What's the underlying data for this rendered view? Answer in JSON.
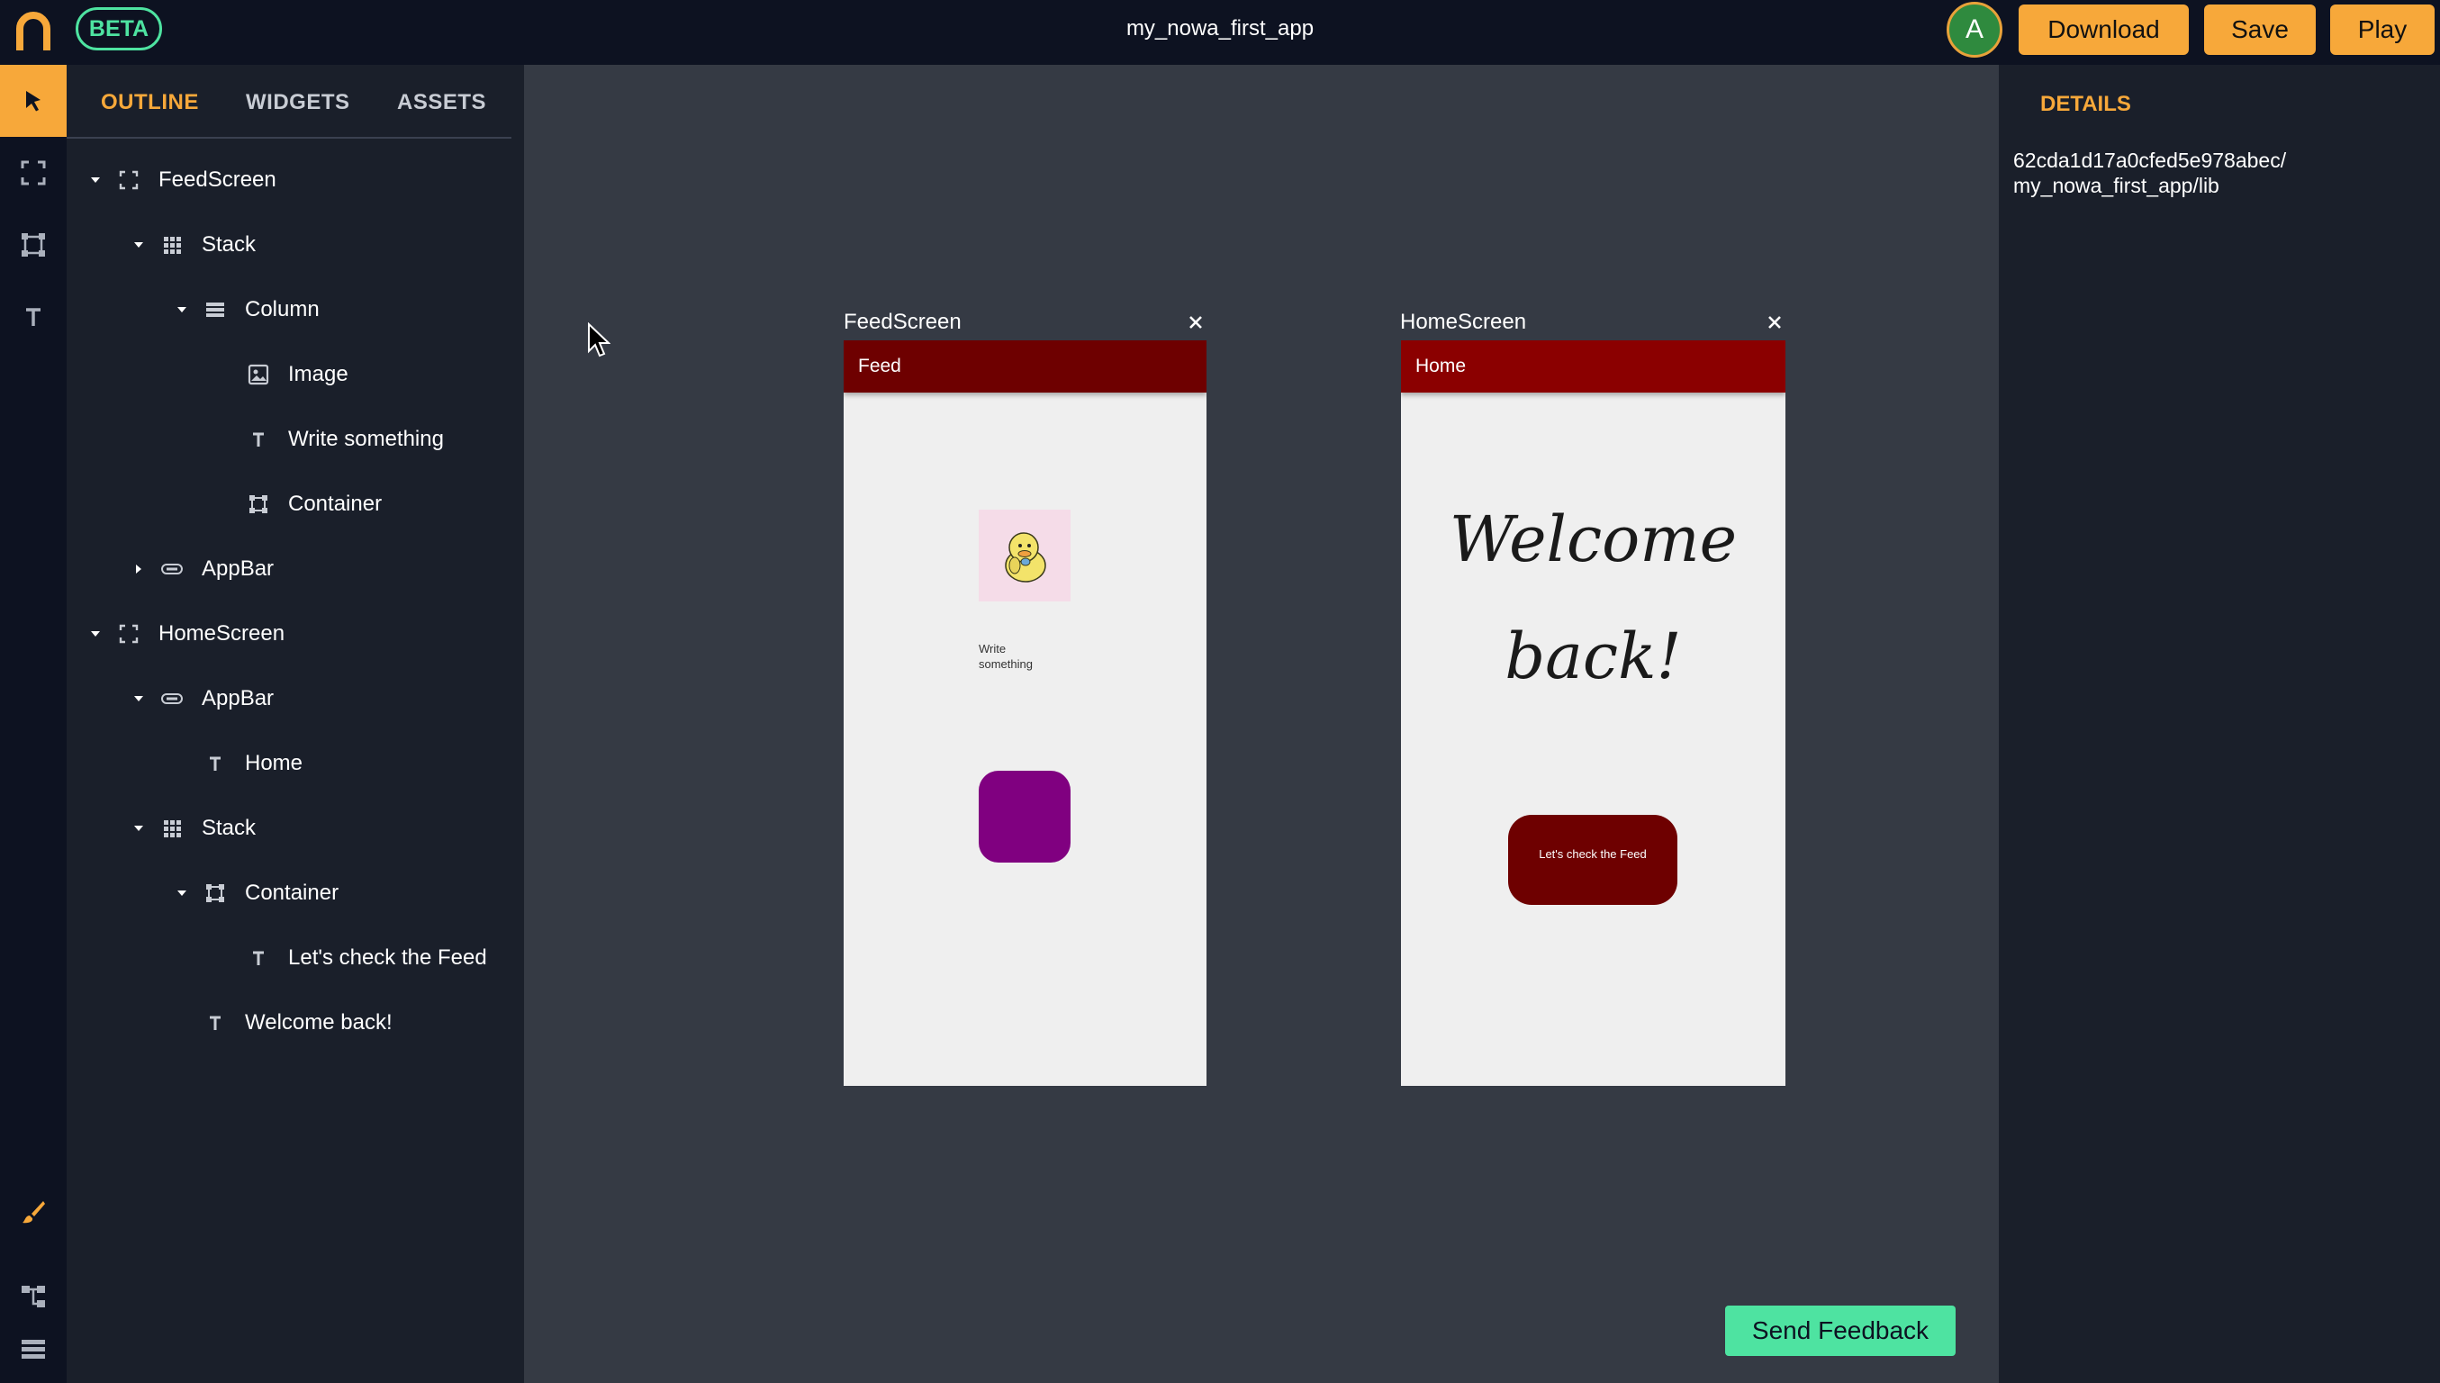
{
  "header": {
    "beta_label": "BETA",
    "app_title": "my_nowa_first_app",
    "avatar_initial": "A",
    "download_label": "Download",
    "save_label": "Save",
    "play_label": "Play"
  },
  "rail": {
    "icons": [
      "pointer-icon",
      "screen-icon",
      "container-icon",
      "text-icon",
      "brush-icon",
      "tree-icon",
      "list-icon"
    ],
    "active": "pointer-icon"
  },
  "outline": {
    "tabs": [
      "OUTLINE",
      "WIDGETS",
      "ASSETS"
    ],
    "active_tab": "OUTLINE",
    "tree": [
      {
        "label": "FeedScreen",
        "icon": "screen-icon",
        "expanded": true
      },
      {
        "label": "Stack",
        "icon": "grid-icon",
        "expanded": true
      },
      {
        "label": "Column",
        "icon": "column-icon",
        "expanded": true
      },
      {
        "label": "Image",
        "icon": "image-icon"
      },
      {
        "label": "Write something",
        "icon": "text-icon"
      },
      {
        "label": "Container",
        "icon": "container-icon"
      },
      {
        "label": "AppBar",
        "icon": "appbar-icon",
        "expanded": false
      },
      {
        "label": "HomeScreen",
        "icon": "screen-icon",
        "expanded": true
      },
      {
        "label": "AppBar",
        "icon": "appbar-icon",
        "expanded": true
      },
      {
        "label": "Home",
        "icon": "text-icon"
      },
      {
        "label": "Stack",
        "icon": "grid-icon",
        "expanded": true
      },
      {
        "label": "Container",
        "icon": "container-icon",
        "expanded": true
      },
      {
        "label": "Let's check the Feed",
        "icon": "text-icon"
      },
      {
        "label": "Welcome back!",
        "icon": "text-icon"
      }
    ]
  },
  "canvas": {
    "feed_screen": {
      "title": "FeedScreen",
      "appbar_title": "Feed",
      "text": "Write\nsomething",
      "appbar_color": "#6e0000",
      "container_color": "#800080"
    },
    "home_screen": {
      "title": "HomeScreen",
      "appbar_title": "Home",
      "welcome_line1": "Welcome",
      "welcome_line2": "back!",
      "button_label": "Let's check the Feed",
      "appbar_color": "#8b0000",
      "button_color": "#6e0000"
    },
    "send_feedback_label": "Send Feedback"
  },
  "details": {
    "title": "DETAILS",
    "path": "62cda1d17a0cfed5e978abec/\nmy_nowa_first_app/lib"
  },
  "colors": {
    "accent": "#f7a83a",
    "beta": "#4ee3a1",
    "panel": "#1a1f2a",
    "canvas": "#353a44"
  }
}
